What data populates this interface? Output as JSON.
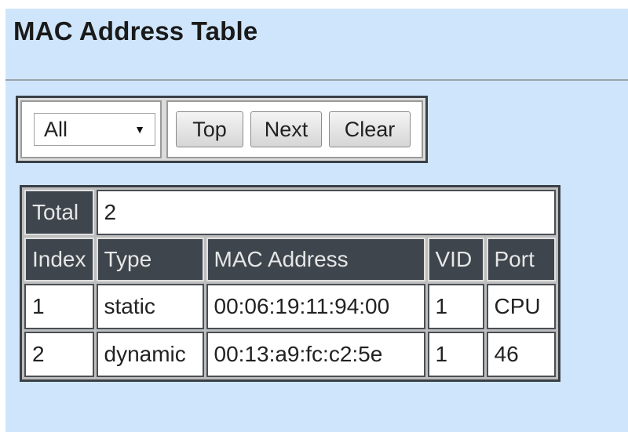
{
  "page": {
    "title": "MAC Address Table"
  },
  "toolbar": {
    "filter_selected": "All",
    "top_label": "Top",
    "next_label": "Next",
    "clear_label": "Clear"
  },
  "table": {
    "total_label": "Total",
    "total_value": "2",
    "headers": [
      "Index",
      "Type",
      "MAC Address",
      "VID",
      "Port"
    ],
    "rows": [
      {
        "index": "1",
        "type": "static",
        "mac": "00:06:19:11:94:00",
        "vid": "1",
        "port": "CPU"
      },
      {
        "index": "2",
        "type": "dynamic",
        "mac": "00:13:a9:fc:c2:5e",
        "vid": "1",
        "port": "46"
      }
    ]
  },
  "colors": {
    "page_background": "#cfe5fb",
    "header_background": "#3e454d",
    "header_text": "#e6e6e6"
  }
}
